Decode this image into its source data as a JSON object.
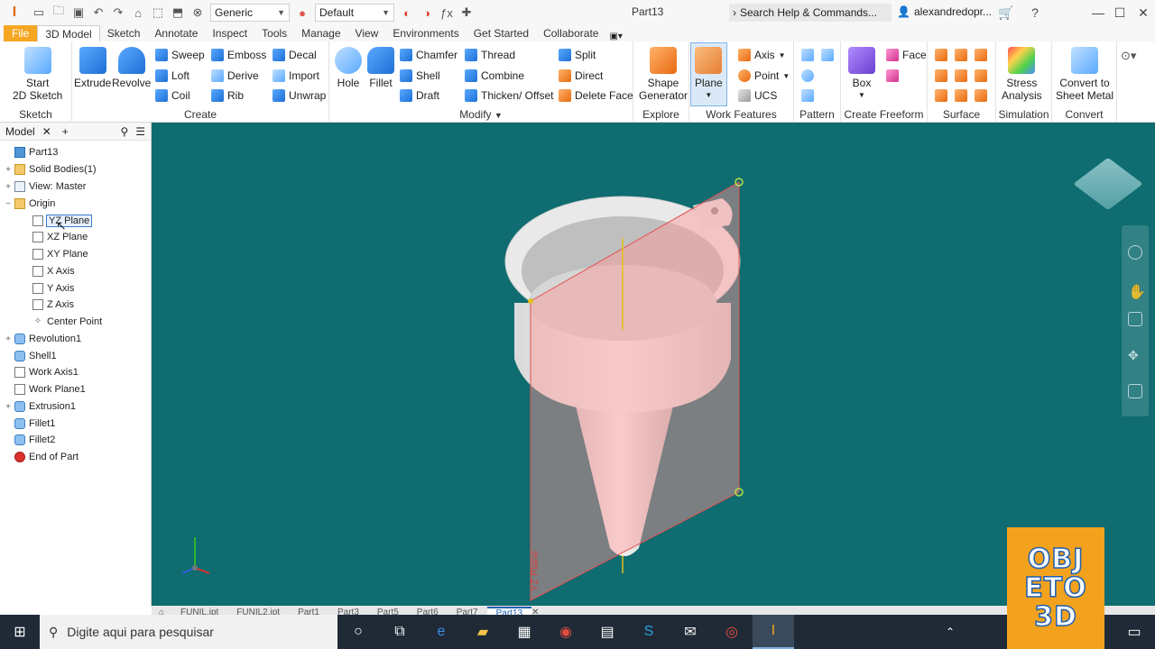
{
  "titlebar": {
    "app_logo": "I",
    "material_dropdown": "Generic",
    "appearance_dropdown": "Default",
    "document_title": "Part13",
    "search_placeholder": "Search Help & Commands...",
    "user_name": "alexandredopr..."
  },
  "ribbon_tabs": [
    "File",
    "3D Model",
    "Sketch",
    "Annotate",
    "Inspect",
    "Tools",
    "Manage",
    "View",
    "Environments",
    "Get Started",
    "Collaborate"
  ],
  "ribbon": {
    "sketch": {
      "start_sketch_line1": "Start",
      "start_sketch_line2": "2D Sketch",
      "panel": "Sketch"
    },
    "create": {
      "extrude": "Extrude",
      "revolve": "Revolve",
      "sweep": "Sweep",
      "loft": "Loft",
      "coil": "Coil",
      "emboss": "Emboss",
      "derive": "Derive",
      "rib": "Rib",
      "decal": "Decal",
      "import": "Import",
      "unwrap": "Unwrap",
      "panel": "Create"
    },
    "modify": {
      "hole": "Hole",
      "fillet": "Fillet",
      "chamfer": "Chamfer",
      "shell": "Shell",
      "draft": "Draft",
      "thread": "Thread",
      "combine": "Combine",
      "thicken": "Thicken/ Offset",
      "split": "Split",
      "direct": "Direct",
      "delete_face": "Delete Face",
      "panel": "Modify"
    },
    "explore": {
      "shape_generator_line1": "Shape",
      "shape_generator_line2": "Generator",
      "panel": "Explore"
    },
    "work_features": {
      "plane": "Plane",
      "axis": "Axis",
      "point": "Point",
      "ucs": "UCS",
      "panel": "Work Features"
    },
    "pattern": {
      "panel": "Pattern"
    },
    "create_freeform": {
      "box": "Box",
      "face": "Face",
      "panel": "Create Freeform"
    },
    "surface": {
      "panel": "Surface"
    },
    "simulation": {
      "stress_line1": "Stress",
      "stress_line2": "Analysis",
      "panel": "Simulation"
    },
    "convert": {
      "convert_line1": "Convert to",
      "convert_line2": "Sheet Metal",
      "panel": "Convert"
    }
  },
  "browser": {
    "tab_label": "Model",
    "tree": [
      {
        "label": "Part13",
        "icon": "part-icon"
      },
      {
        "label": "Solid Bodies(1)",
        "icon": "folder-icon"
      },
      {
        "label": "View: Master",
        "icon": "view-icon"
      },
      {
        "label": "Origin",
        "icon": "folder-icon"
      },
      {
        "label": "YZ Plane",
        "icon": "plane-icon"
      },
      {
        "label": "XZ Plane",
        "icon": "plane-icon"
      },
      {
        "label": "XY Plane",
        "icon": "plane-icon"
      },
      {
        "label": "X Axis",
        "icon": "axis-icon"
      },
      {
        "label": "Y Axis",
        "icon": "axis-icon"
      },
      {
        "label": "Z Axis",
        "icon": "axis-icon"
      },
      {
        "label": "Center Point",
        "icon": "point-icon"
      },
      {
        "label": "Revolution1",
        "icon": "revolve-icon"
      },
      {
        "label": "Shell1",
        "icon": "shell-icon"
      },
      {
        "label": "Work Axis1",
        "icon": "axis-icon"
      },
      {
        "label": "Work Plane1",
        "icon": "plane-icon"
      },
      {
        "label": "Extrusion1",
        "icon": "extrude-icon"
      },
      {
        "label": "Fillet1",
        "icon": "fillet-icon"
      },
      {
        "label": "Fillet2",
        "icon": "fillet-icon"
      },
      {
        "label": "End of Part",
        "icon": "end-of-part-icon"
      }
    ]
  },
  "viewport": {
    "background": "#0f6c70",
    "workplane_label": "YZ Plane"
  },
  "doc_tabs": [
    "FUNIL.ipt",
    "FUNIL2.ipt",
    "Part1",
    "Part3",
    "Part5",
    "Part6",
    "Part7",
    "Part13"
  ],
  "taskbar": {
    "search_placeholder": "Digite aqui para pesquisar"
  },
  "watermark": {
    "line1": "OBJ",
    "line2": "ETO",
    "line3": "3D"
  }
}
